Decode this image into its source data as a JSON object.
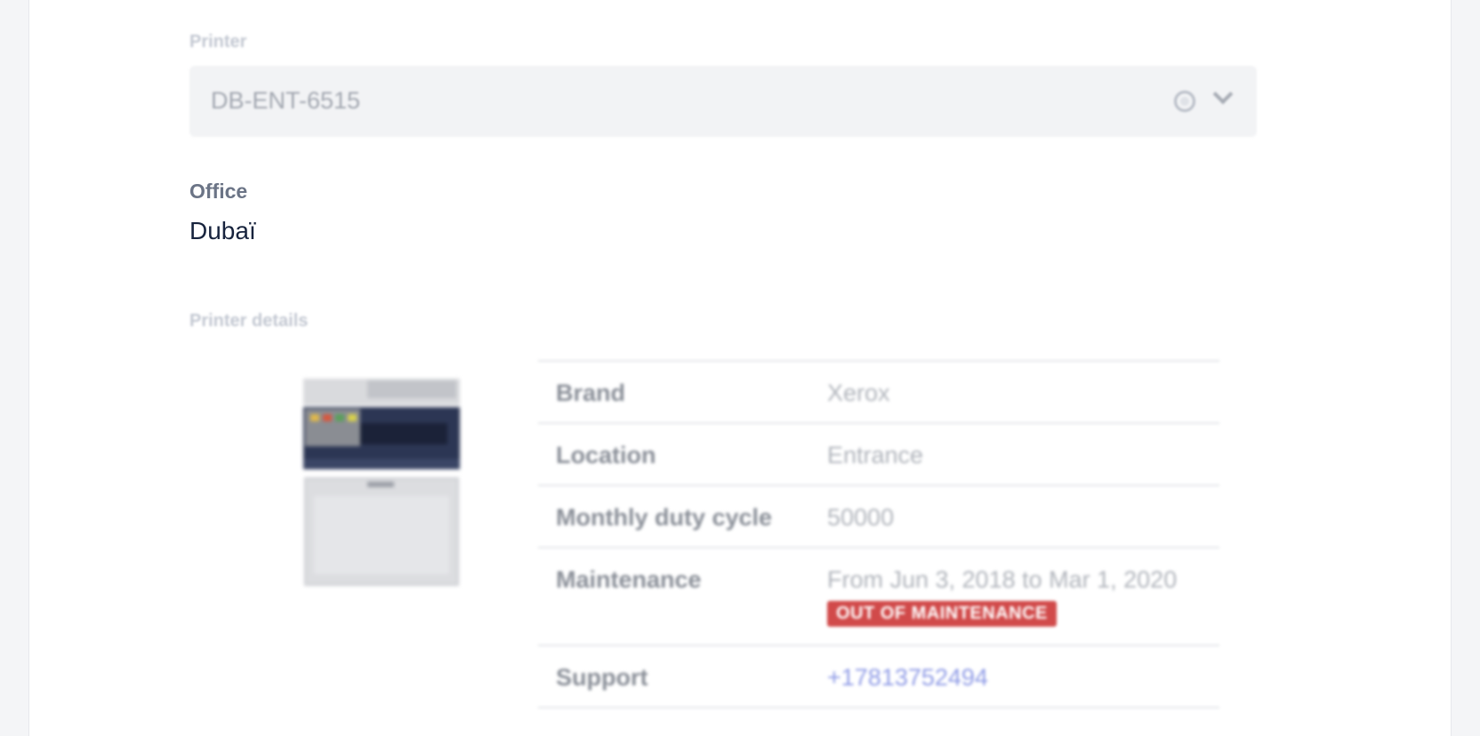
{
  "printer": {
    "label": "Printer",
    "selected_value": "DB-ENT-6515"
  },
  "office": {
    "label": "Office",
    "value": "Dubaï"
  },
  "printer_details": {
    "title": "Printer details",
    "image_icon": "printer-image",
    "rows": [
      {
        "key": "Brand",
        "value": "Xerox"
      },
      {
        "key": "Location",
        "value": "Entrance"
      },
      {
        "key": "Monthly duty cycle",
        "value": "50000"
      },
      {
        "key": "Maintenance",
        "value": "From Jun 3, 2018 to Mar 1, 2020",
        "badge": "OUT OF MAINTENANCE"
      },
      {
        "key": "Support",
        "value": "+17813752494"
      }
    ]
  },
  "colors": {
    "badge_bg": "#d14a4a",
    "link": "#8f9be6",
    "label": "#6b7486",
    "text": "#17233d"
  }
}
